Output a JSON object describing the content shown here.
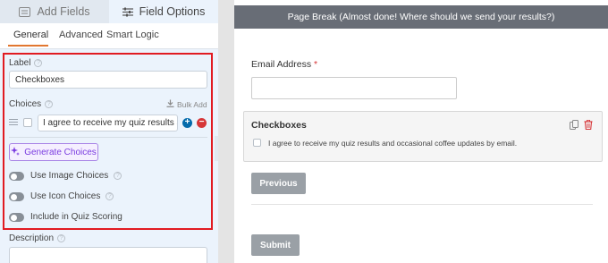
{
  "left_tabs": {
    "add_fields": "Add Fields",
    "field_options": "Field Options"
  },
  "subtabs": [
    "General",
    "Advanced",
    "Smart Logic"
  ],
  "label_section": {
    "label": "Label",
    "value": "Checkboxes"
  },
  "choices_section": {
    "label": "Choices",
    "bulk_add": "Bulk Add",
    "choice_value": "I agree to receive my quiz results and occasional coffee updates by email."
  },
  "generate_button": "Generate Choices",
  "toggles": [
    {
      "label": "Use Image Choices",
      "on": false
    },
    {
      "label": "Use Icon Choices",
      "on": false
    },
    {
      "label": "Include in Quiz Scoring",
      "on": false
    }
  ],
  "description_label": "Description",
  "preview": {
    "page_break": "Page Break (Almost done! Where should we send your results?)",
    "email_label": "Email Address",
    "required_mark": "*",
    "checkbox_title": "Checkboxes",
    "checkbox_choice": "I agree to receive my quiz results and occasional coffee updates by email.",
    "previous_button": "Previous",
    "submit_button": "Submit"
  },
  "icons": {
    "add_fields": "list-icon",
    "field_options": "sliders-icon",
    "bulk_add": "download-icon",
    "generate": "sparkle-icon",
    "duplicate": "copy-icon",
    "delete": "trash-icon",
    "collapse": "chevron-left-icon"
  },
  "colors": {
    "accent_orange": "#e27730",
    "highlight_red": "#e11b22",
    "add_blue": "#036aab",
    "remove_red": "#d63638",
    "generate_purple": "#7a3be0",
    "page_break_bar": "#686d76",
    "button_gray": "#9aa0a6"
  }
}
